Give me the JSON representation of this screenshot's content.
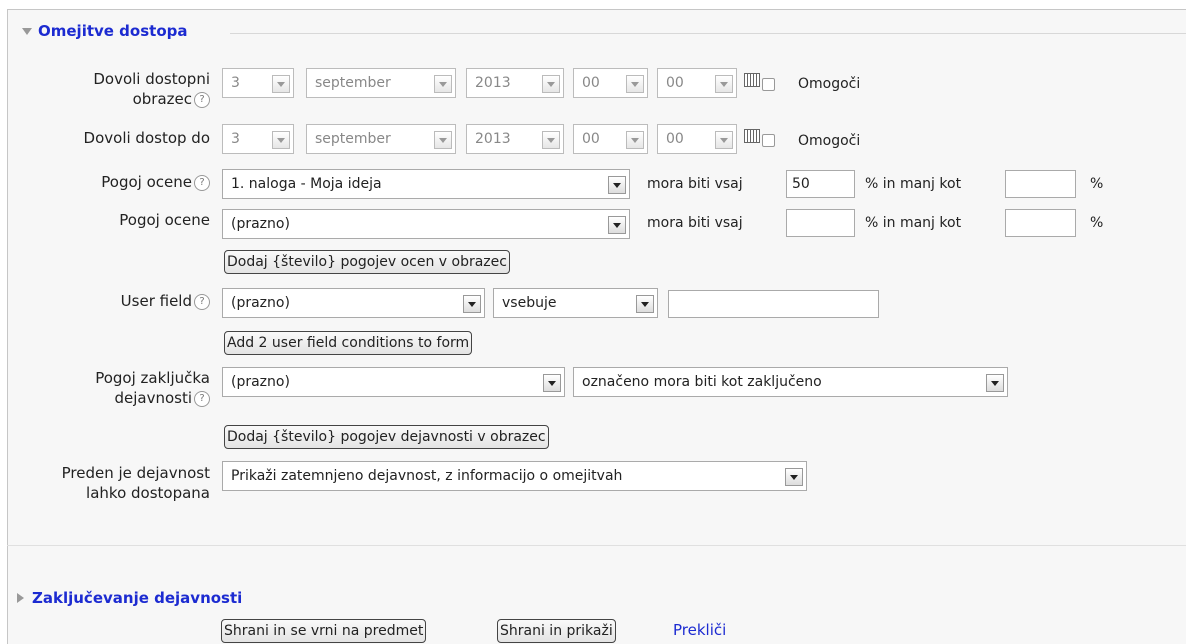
{
  "section": {
    "title": "Omejitve dostopa"
  },
  "access_from": {
    "label_line1": "Dovoli dostopni",
    "label_line2": "obrazec",
    "day": "3",
    "month": "september",
    "year": "2013",
    "hour": "00",
    "minute": "00",
    "enable_label": "Omogoči"
  },
  "access_until": {
    "label": "Dovoli dostop do",
    "day": "3",
    "month": "september",
    "year": "2013",
    "hour": "00",
    "minute": "00",
    "enable_label": "Omogoči"
  },
  "grade_conditions": [
    {
      "label": "Pogoj ocene",
      "item": "1. naloga - Moja ideja",
      "min_label": "mora biti vsaj",
      "min_value": "50",
      "max_label": "% in manj kot",
      "max_value": "",
      "pct": "%"
    },
    {
      "label": "Pogoj ocene",
      "item": "(prazno)",
      "min_label": "mora biti vsaj",
      "min_value": "",
      "max_label": "% in manj kot",
      "max_value": "",
      "pct": "%"
    }
  ],
  "add_grade_button": "Dodaj {število} pogojev ocen v obrazec",
  "user_field": {
    "label": "User field",
    "field": "(prazno)",
    "operator": "vsebuje",
    "value": ""
  },
  "add_user_field_button": "Add 2 user field conditions to form",
  "completion": {
    "label_line1": "Pogoj zaključka",
    "label_line2": "dejavnosti",
    "activity": "(prazno)",
    "state": "označeno mora biti kot zaključeno"
  },
  "add_completion_button": "Dodaj {število} pogojev dejavnosti v obrazec",
  "before_access": {
    "label_line1": "Preden je dejavnost",
    "label_line2": "lahko dostopana",
    "value": "Prikaži zatemnjeno dejavnost, z informacijo o omejitvah"
  },
  "section2": {
    "title": "Zaključevanje dejavnosti"
  },
  "footer": {
    "save_return": "Shrani in se vrni na predmet",
    "save_display": "Shrani in prikaži",
    "cancel": "Prekliči"
  }
}
